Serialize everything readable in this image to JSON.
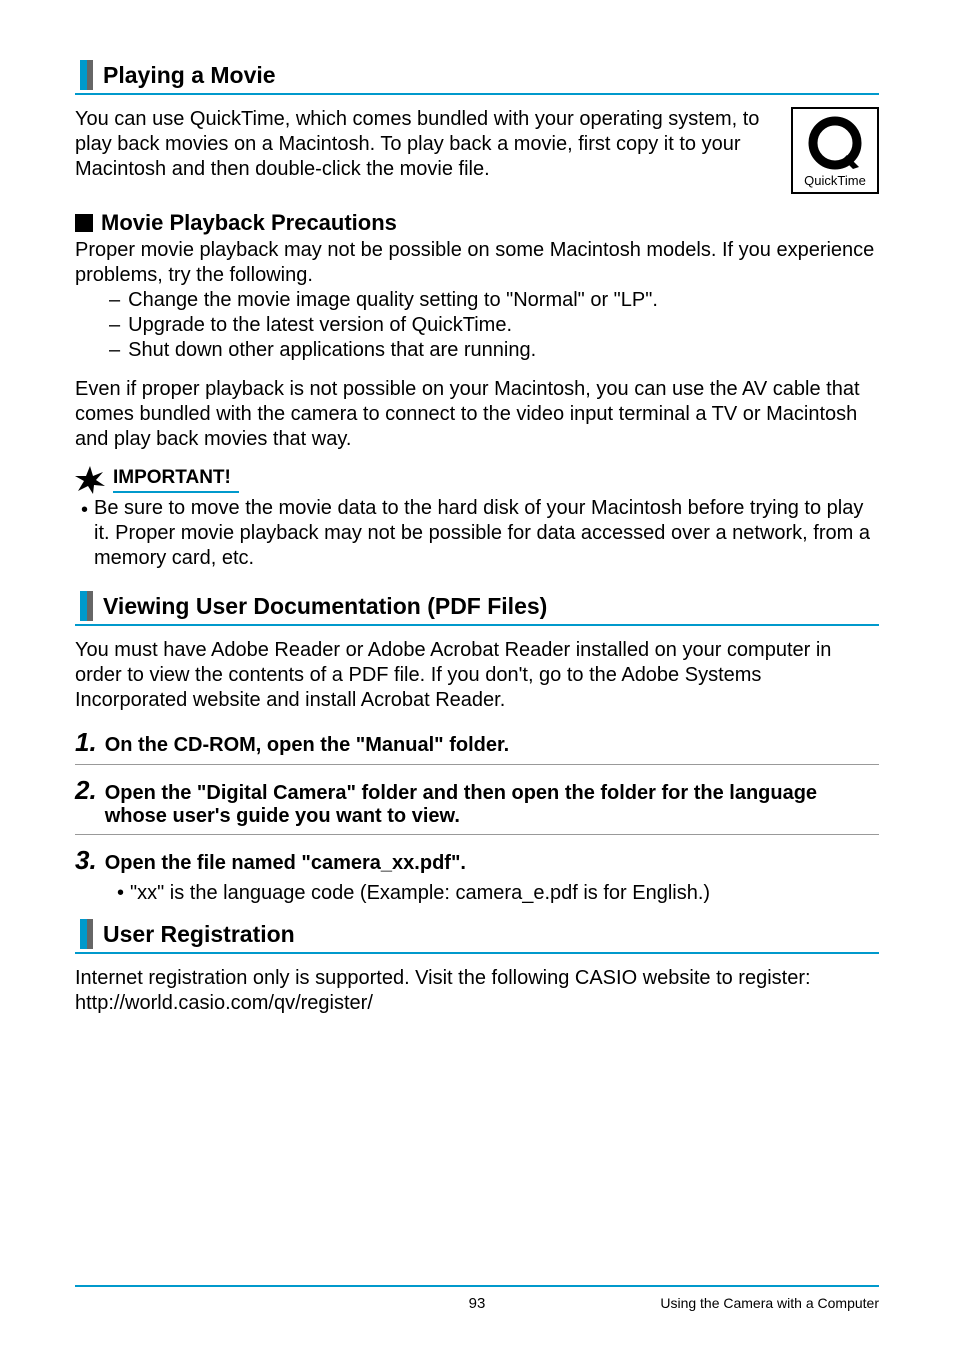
{
  "section1": {
    "title": "Playing a Movie",
    "intro": "You can use QuickTime, which comes bundled with your operating system, to play back movies on a Macintosh. To play back a movie, first copy it to your Macintosh and then double-click the movie file.",
    "icon_label": "QuickTime"
  },
  "sub1": {
    "title": "Movie Playback Precautions",
    "text1": "Proper movie playback may not be possible on some Macintosh models. If you experience problems, try the following.",
    "items": [
      "Change the movie image quality setting to \"Normal\" or \"LP\".",
      "Upgrade to the latest version of QuickTime.",
      "Shut down other applications that are running."
    ],
    "text2": "Even if proper playback is not possible on your Macintosh, you can use the AV cable that comes bundled with the camera to connect to the video input terminal a TV or Macintosh and play back movies that way."
  },
  "important": {
    "label": "IMPORTANT!",
    "text": "Be sure to move the movie data to the hard disk of your Macintosh before trying to play it. Proper movie playback may not be possible for data accessed over a network, from a memory card, etc."
  },
  "section2": {
    "title": "Viewing User Documentation (PDF Files)",
    "intro": "You must have Adobe Reader or Adobe Acrobat Reader installed on your computer in order to view the contents of a PDF file. If you don't, go to the Adobe Systems Incorporated website and install Acrobat Reader."
  },
  "steps": {
    "s1": "On the CD-ROM, open the \"Manual\" folder.",
    "s2": "Open the \"Digital Camera\" folder and then open the folder for the language whose user's guide you want to view.",
    "s3": "Open the file named \"camera_xx.pdf\".",
    "s3_sub": "\"xx\" is the language code (Example: camera_e.pdf is for English.)"
  },
  "section3": {
    "title": "User Registration",
    "text": "Internet registration only is supported. Visit the following CASIO website to register:\nhttp://world.casio.com/qv/register/"
  },
  "footer": {
    "page": "93",
    "chapter": "Using the Camera with a Computer"
  }
}
